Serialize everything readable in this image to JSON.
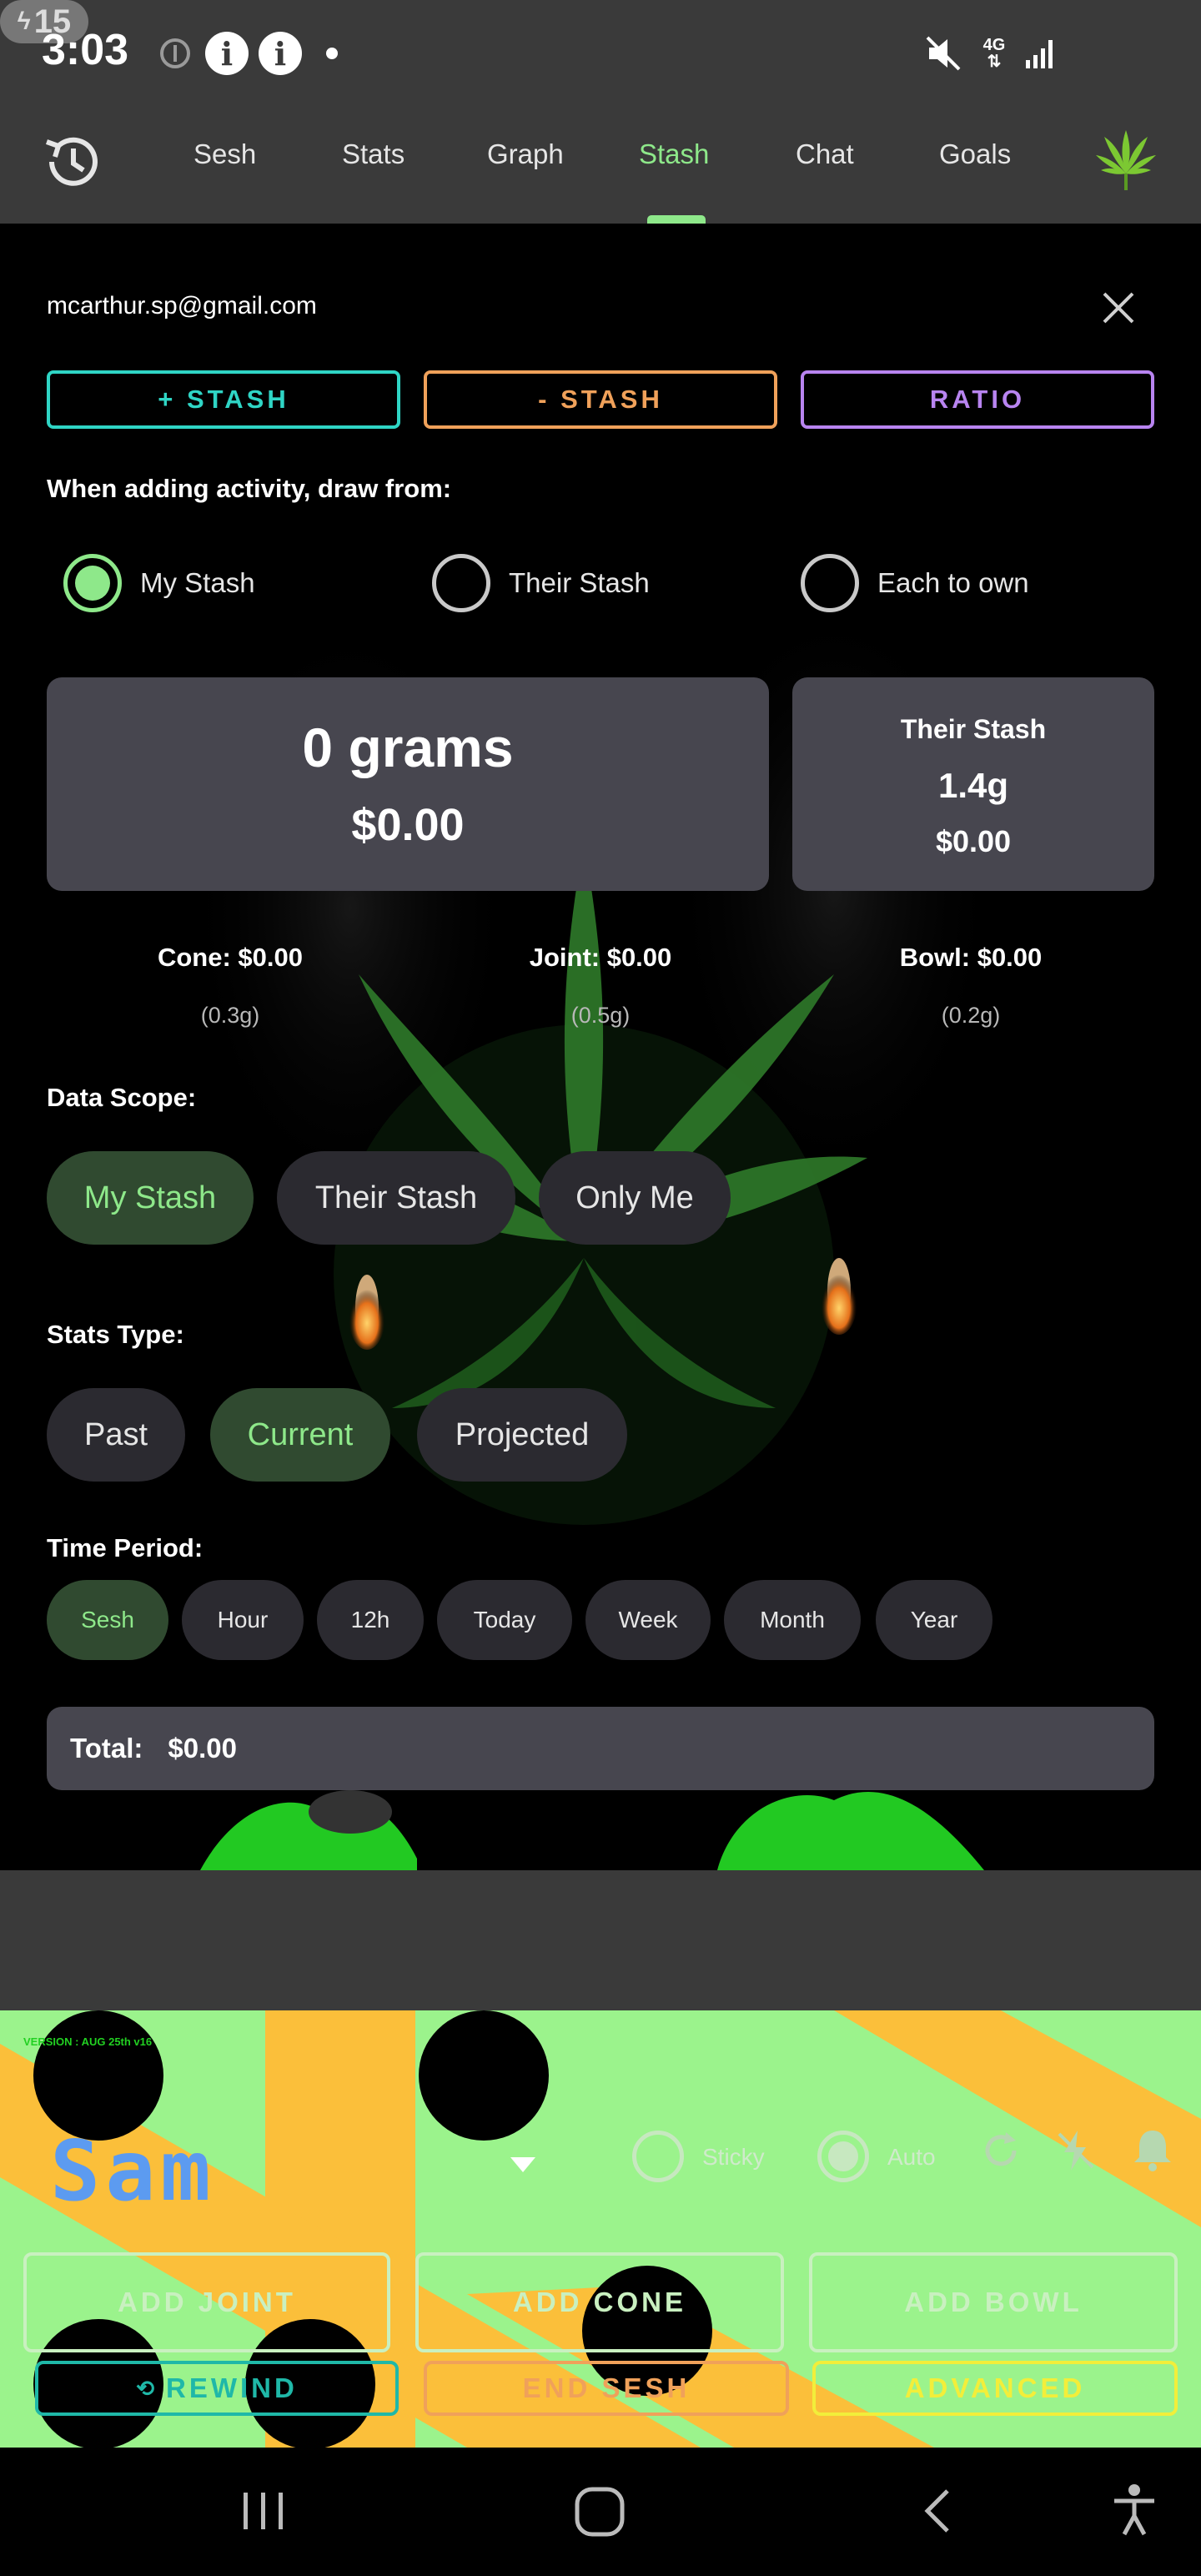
{
  "status_bar": {
    "time": "3:03",
    "network_label": "4G",
    "battery_level": "15",
    "icons": [
      "alert-circle-icon",
      "info-icon",
      "info-icon",
      "dot-icon",
      "mute-icon",
      "network-arrows-icon",
      "signal-bars-icon",
      "battery-charging-icon"
    ]
  },
  "nav": {
    "history_icon": "history-icon",
    "tabs": [
      {
        "label": "Sesh"
      },
      {
        "label": "Stats"
      },
      {
        "label": "Graph"
      },
      {
        "label": "Stash"
      },
      {
        "label": "Chat"
      },
      {
        "label": "Goals"
      }
    ],
    "active_tab": "Stash",
    "logo_icon": "cannabis-leaf-icon"
  },
  "stash_panel": {
    "email": "mcarthur.sp@gmail.com",
    "close_icon": "close-icon",
    "buttons": {
      "add_stash": "+ STASH",
      "remove_stash": "- STASH",
      "ratio": "RATIO"
    },
    "draw_from_label": "When adding activity, draw from:",
    "draw_from_options": [
      {
        "label": "My Stash",
        "selected": true
      },
      {
        "label": "Their Stash",
        "selected": false
      },
      {
        "label": "Each to own",
        "selected": false
      }
    ],
    "my_stash": {
      "grams": "0 grams",
      "value": "$0.00"
    },
    "their_stash": {
      "title": "Their Stash",
      "grams": "1.4g",
      "value": "$0.00"
    },
    "costs": [
      {
        "label": "Cone: $0.00",
        "amount": "(0.3g)"
      },
      {
        "label": "Joint: $0.00",
        "amount": "(0.5g)"
      },
      {
        "label": "Bowl: $0.00",
        "amount": "(0.2g)"
      }
    ],
    "data_scope": {
      "label": "Data Scope:",
      "options": [
        "My Stash",
        "Their Stash",
        "Only Me"
      ],
      "selected": "My Stash"
    },
    "stats_type": {
      "label": "Stats Type:",
      "options": [
        "Past",
        "Current",
        "Projected"
      ],
      "selected": "Current"
    },
    "time_period": {
      "label": "Time Period:",
      "options": [
        "Sesh",
        "Hour",
        "12h",
        "Today",
        "Week",
        "Month",
        "Year"
      ],
      "selected": "Sesh"
    },
    "total": {
      "label": "Total:",
      "value": "$0.00"
    }
  },
  "dock": {
    "version_text": "VERSION : AUG 25th v16",
    "user_name": "Sam",
    "chevron_icon": "chevron-down-icon",
    "toggles": [
      {
        "label": "Sticky",
        "checked": false
      },
      {
        "label": "Auto",
        "checked": true
      }
    ],
    "icons": [
      "refresh-icon",
      "flash-off-icon",
      "bell-icon"
    ],
    "buttons": {
      "add_joint": "ADD JOINT",
      "add_cone": "ADD CONE",
      "add_bowl": "ADD BOWL",
      "rewind": "REWIND",
      "end_sesh": "END SESH",
      "advanced": "ADVANCED"
    },
    "colors": {
      "background": "#9bf38c",
      "stripe": "#fbbf3a",
      "rewind": "#1fb8a8",
      "end_sesh": "#f0a15a",
      "advanced": "#f2ee3a"
    }
  },
  "system_nav": {
    "icons": [
      "recents-icon",
      "home-icon",
      "back-icon",
      "accessibility-icon"
    ]
  },
  "colors": {
    "accent": "#8ee88a",
    "add_stash": "#2fd5c5",
    "remove_stash": "#f0a15a",
    "ratio": "#b884f0",
    "card": "#47464f",
    "panel_bar": "#3a3a3a"
  }
}
